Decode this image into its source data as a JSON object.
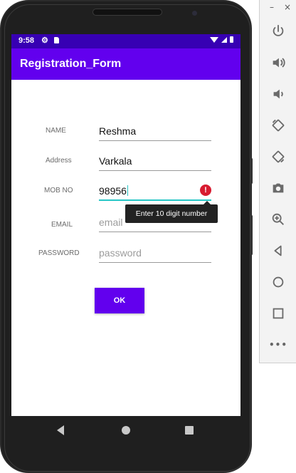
{
  "status_bar": {
    "time": "9:58"
  },
  "app_bar": {
    "title": "Registration_Form"
  },
  "form": {
    "name": {
      "label": "NAME",
      "value": "Reshma"
    },
    "address": {
      "label": "Address",
      "value": "Varkala"
    },
    "mob_no": {
      "label": "MOB NO",
      "value": "98956",
      "error": "Enter 10 digit number"
    },
    "email": {
      "label": "EMAIL",
      "placeholder": "email"
    },
    "password": {
      "label": "PASSWORD",
      "placeholder": "password"
    },
    "ok_button": "OK"
  },
  "toolbar": {
    "minimize": "–",
    "close": "×",
    "more": "•••",
    "icons": [
      "power-icon",
      "volume-up-icon",
      "volume-down-icon",
      "rotate-left-icon",
      "rotate-right-icon",
      "camera-icon",
      "zoom-icon",
      "back-icon",
      "home-icon",
      "overview-icon",
      "more-icon"
    ]
  },
  "colors": {
    "status_bar": "#3700b3",
    "app_bar": "#6200ee",
    "button": "#6200ee",
    "active_underline": "#26c6c6",
    "error": "#d81b30"
  }
}
